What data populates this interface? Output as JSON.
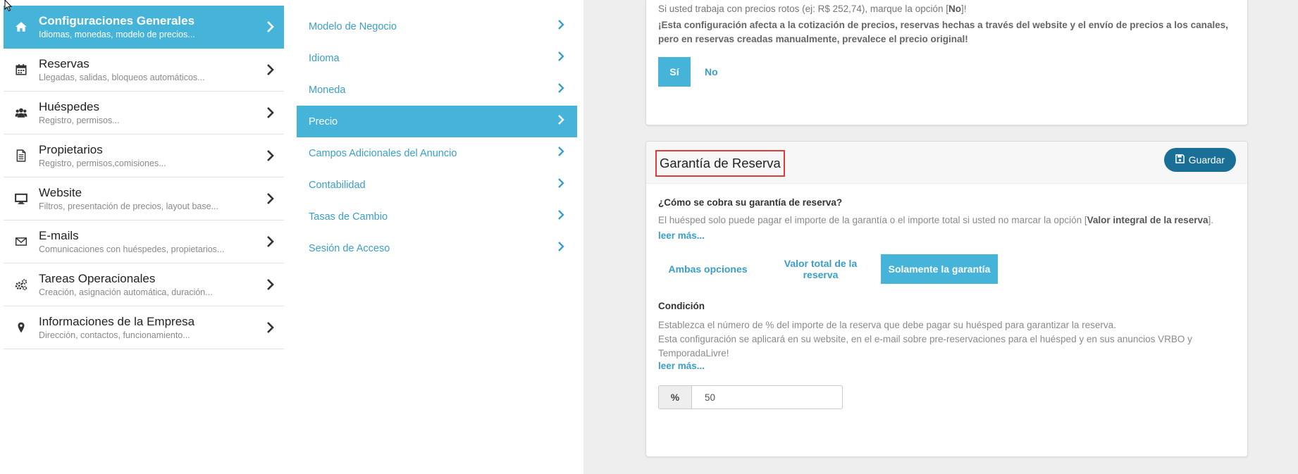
{
  "sidebar": {
    "items": [
      {
        "title": "Configuraciones Generales",
        "sub": "Idiomas, monedas, modelo de precios...",
        "icon": "home-icon",
        "active": true
      },
      {
        "title": "Reservas",
        "sub": "Llegadas, salidas, bloqueos automáticos...",
        "icon": "calendar-icon"
      },
      {
        "title": "Huéspedes",
        "sub": "Registro, permisos...",
        "icon": "users-icon"
      },
      {
        "title": "Propietarios",
        "sub": "Registro, permisos,comisiones...",
        "icon": "document-icon"
      },
      {
        "title": "Website",
        "sub": "Filtros, presentación de precios, layout base...",
        "icon": "monitor-icon"
      },
      {
        "title": "E-mails",
        "sub": "Comunicaciones con huéspedes, propietarios...",
        "icon": "envelope-icon"
      },
      {
        "title": "Tareas Operacionales",
        "sub": "Creación, asignación automática, duración...",
        "icon": "gears-icon"
      },
      {
        "title": "Informaciones de la Empresa",
        "sub": "Dirección, contactos, funcionamiento...",
        "icon": "map-pin-icon"
      }
    ]
  },
  "submenu": {
    "items": [
      {
        "label": "Modelo de Negocio"
      },
      {
        "label": "Idioma"
      },
      {
        "label": "Moneda"
      },
      {
        "label": "Precio",
        "active": true
      },
      {
        "label": "Campos Adicionales del Anuncio"
      },
      {
        "label": "Contabilidad"
      },
      {
        "label": "Tasas de Cambio"
      },
      {
        "label": "Sesión de Acceso"
      }
    ]
  },
  "card1": {
    "line1_prefix": "Si usted trabaja con precios rotos (ej: R$ 252,74), marque la opción [",
    "line1_bold": "No",
    "line1_suffix": "]!",
    "warning": "¡Esta configuración afecta a la cotización de precios, reservas hechas a través del website y el envío de precios a los canales, pero en reservas creadas manualmente, prevalece el precio original!",
    "btn_si": "Sí",
    "btn_no": "No"
  },
  "card2": {
    "title": "Garantía de Reserva",
    "save_label": "Guardar",
    "question": "¿Cómo se cobra su garantía de reserva?",
    "desc_prefix": "El huésped solo puede pagar el importe de la garantía o el importe total si usted no marcar la opción [",
    "desc_bold": "Valor integral de la reserva",
    "desc_suffix": "].",
    "read_more": "leer más...",
    "options": [
      "Ambas opciones",
      "Valor total de la reserva",
      "Solamente la garantía"
    ],
    "condition_label": "Condición",
    "condition_line1": "Establezca el número de % del importe de la reserva que debe pagar su huésped para garantizar la reserva.",
    "condition_line2": "Esta configuración se aplicará en su website, en el e-mail sobre pre-reservaciones para el huésped y en sus anuncios VRBO y TemporadaLivre!",
    "read_more2": "leer más...",
    "pct_addon": "%",
    "pct_value": "50"
  },
  "colors": {
    "accent": "#46b3d9",
    "link": "#3a9fc8",
    "save_button": "#1a6f96",
    "highlight_border": "#e03c3c"
  }
}
